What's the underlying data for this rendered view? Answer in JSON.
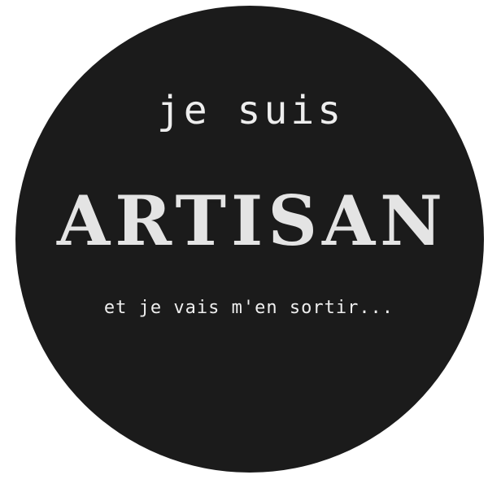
{
  "badge": {
    "line_top": "je suis",
    "line_main": "ARTISAN",
    "line_bottom": "et je vais m'en sortir..."
  },
  "colors": {
    "background": "#ffffff",
    "circle": "#1b1b1b",
    "text": "#eeeeee"
  }
}
